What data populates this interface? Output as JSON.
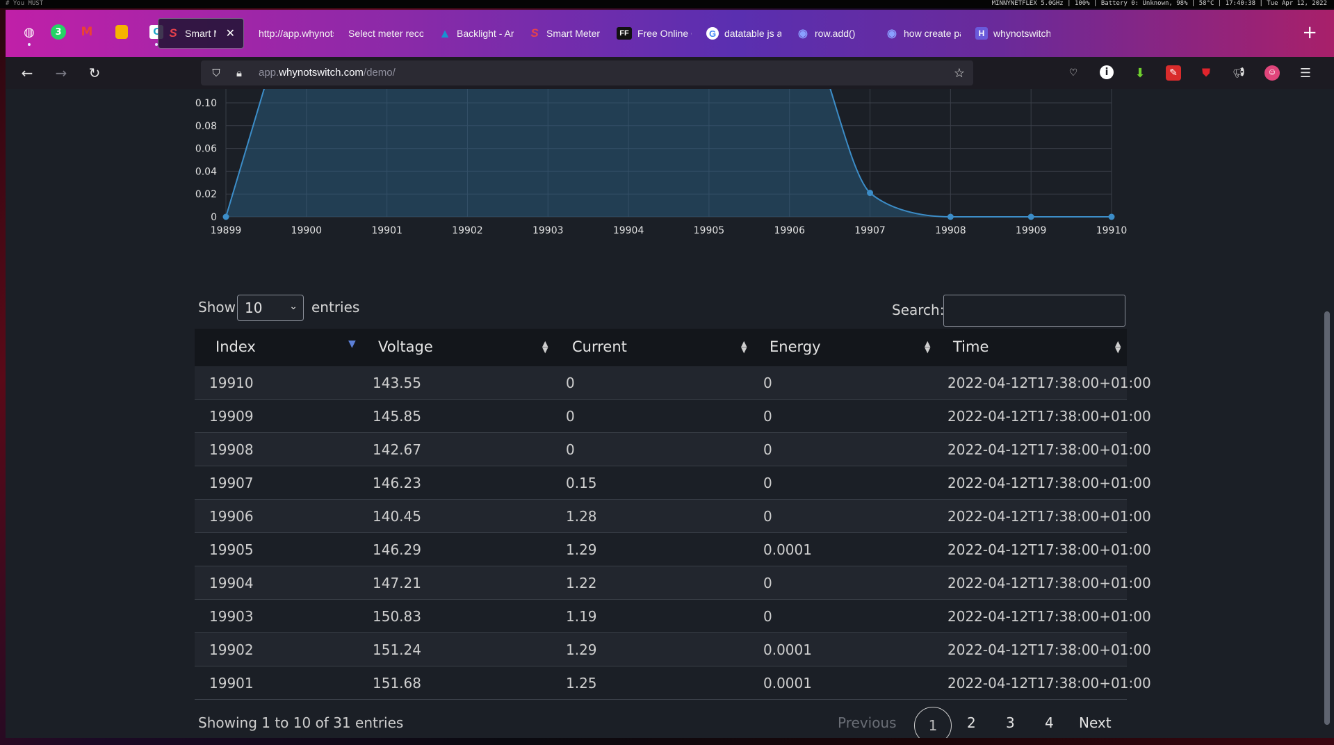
{
  "system_bar": {
    "left": "#  You  MUST",
    "right": "MINNYNETFLEX 5.0GHz | 100% | Battery 0: Unknown, 98% | 58°C | 17:40:38 | Tue Apr 12, 2022"
  },
  "tabs": [
    {
      "label": "Smart Meter",
      "favicon": "S",
      "active": true
    },
    {
      "label": "http://app.whynotsw",
      "favicon": ""
    },
    {
      "label": "Select meter record",
      "favicon": ""
    },
    {
      "label": "Backlight - Arch",
      "favicon": "A"
    },
    {
      "label": "Smart Meter De",
      "favicon": "S"
    },
    {
      "label": "Free Online CS",
      "favicon": "FF"
    },
    {
      "label": "datatable js add",
      "favicon": "G"
    },
    {
      "label": "row.add()",
      "favicon": "◉"
    },
    {
      "label": "how create pag",
      "favicon": "◉"
    },
    {
      "label": "whynotswitch -",
      "favicon": "H"
    }
  ],
  "url": {
    "prefix": "app.",
    "host": "whynotswitch.com",
    "path": "/demo/"
  },
  "chart_data": {
    "type": "area",
    "x": [
      19899,
      19900,
      19901,
      19902,
      19903,
      19904,
      19905,
      19906,
      19907,
      19908,
      19909,
      19910
    ],
    "y_ticks": [
      "0",
      "0.02",
      "0.04",
      "0.06",
      "0.08",
      "0.10"
    ],
    "x_ticks": [
      "19899",
      "19900",
      "19901",
      "19902",
      "19903",
      "19904",
      "19905",
      "19906",
      "19907",
      "19908",
      "19909",
      "19910"
    ],
    "visible_points": [
      {
        "x": 19899,
        "y": 0
      },
      {
        "x": 19907,
        "y": 0.021
      },
      {
        "x": 19908,
        "y": 0
      },
      {
        "x": 19909,
        "y": 0
      },
      {
        "x": 19910,
        "y": 0
      }
    ],
    "ylim": [
      0,
      0.1
    ],
    "grid": true,
    "color": "#3c8dc8"
  },
  "controls": {
    "show_label": "Show",
    "entries_label": "entries",
    "page_size": "10",
    "search_label": "Search:",
    "search_value": ""
  },
  "table": {
    "columns": [
      "Index",
      "Voltage",
      "Current",
      "Energy",
      "Time"
    ],
    "rows": [
      [
        "19910",
        "143.55",
        "0",
        "0",
        "2022-04-12T17:38:00+01:00"
      ],
      [
        "19909",
        "145.85",
        "0",
        "0",
        "2022-04-12T17:38:00+01:00"
      ],
      [
        "19908",
        "142.67",
        "0",
        "0",
        "2022-04-12T17:38:00+01:00"
      ],
      [
        "19907",
        "146.23",
        "0.15",
        "0",
        "2022-04-12T17:38:00+01:00"
      ],
      [
        "19906",
        "140.45",
        "1.28",
        "0",
        "2022-04-12T17:38:00+01:00"
      ],
      [
        "19905",
        "146.29",
        "1.29",
        "0.0001",
        "2022-04-12T17:38:00+01:00"
      ],
      [
        "19904",
        "147.21",
        "1.22",
        "0",
        "2022-04-12T17:38:00+01:00"
      ],
      [
        "19903",
        "150.83",
        "1.19",
        "0",
        "2022-04-12T17:38:00+01:00"
      ],
      [
        "19902",
        "151.24",
        "1.29",
        "0.0001",
        "2022-04-12T17:38:00+01:00"
      ],
      [
        "19901",
        "151.68",
        "1.25",
        "0.0001",
        "2022-04-12T17:38:00+01:00"
      ]
    ]
  },
  "footer": {
    "info": "Showing 1 to 10 of 31 entries",
    "previous": "Previous",
    "pages": [
      "1",
      "2",
      "3",
      "4"
    ],
    "current_page": "1",
    "next": "Next"
  }
}
